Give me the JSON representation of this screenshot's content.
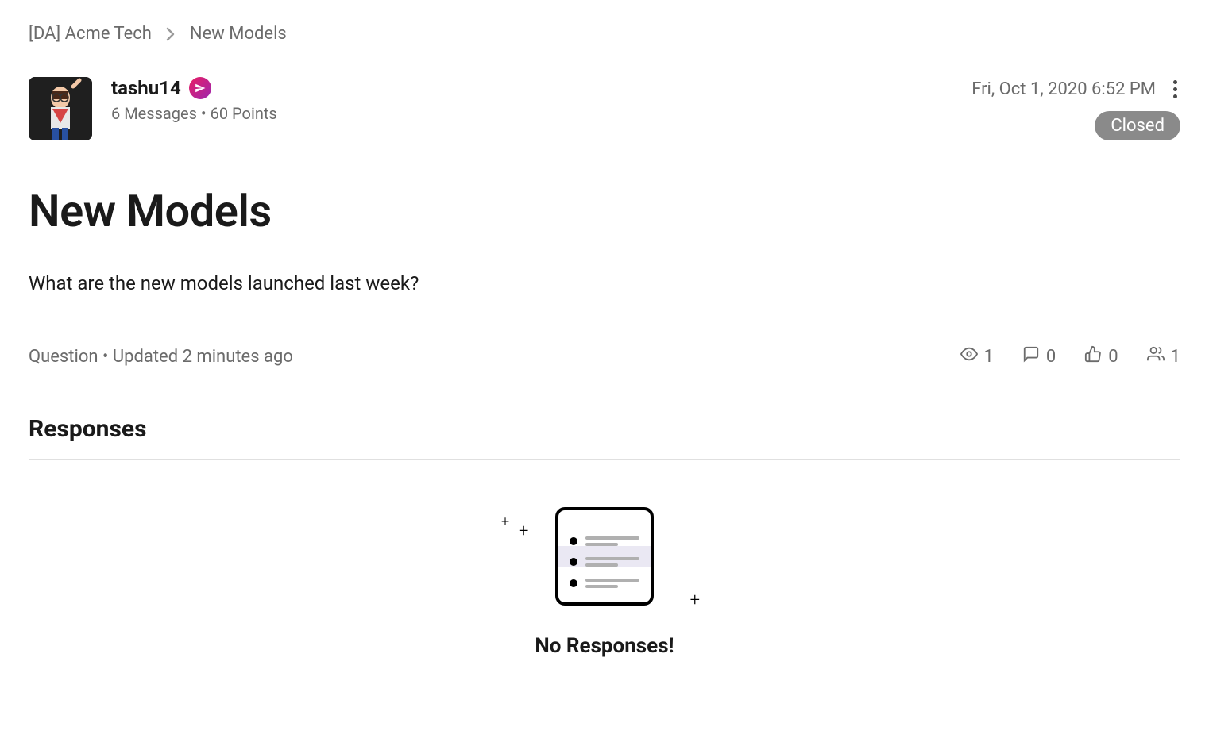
{
  "breadcrumb": {
    "parent": "[DA] Acme Tech",
    "current": "New Models"
  },
  "author": {
    "name": "tashu14",
    "meta": "6 Messages • 60 Points"
  },
  "post": {
    "timestamp": "Fri, Oct 1, 2020 6:52 PM",
    "status": "Closed",
    "title": "New Models",
    "body": "What are the new models launched last week?",
    "type_line": "Question • Updated 2 minutes ago"
  },
  "engagement": {
    "views": "1",
    "comments": "0",
    "likes": "0",
    "followers": "1"
  },
  "responses": {
    "heading": "Responses",
    "empty_message": "No Responses!"
  }
}
